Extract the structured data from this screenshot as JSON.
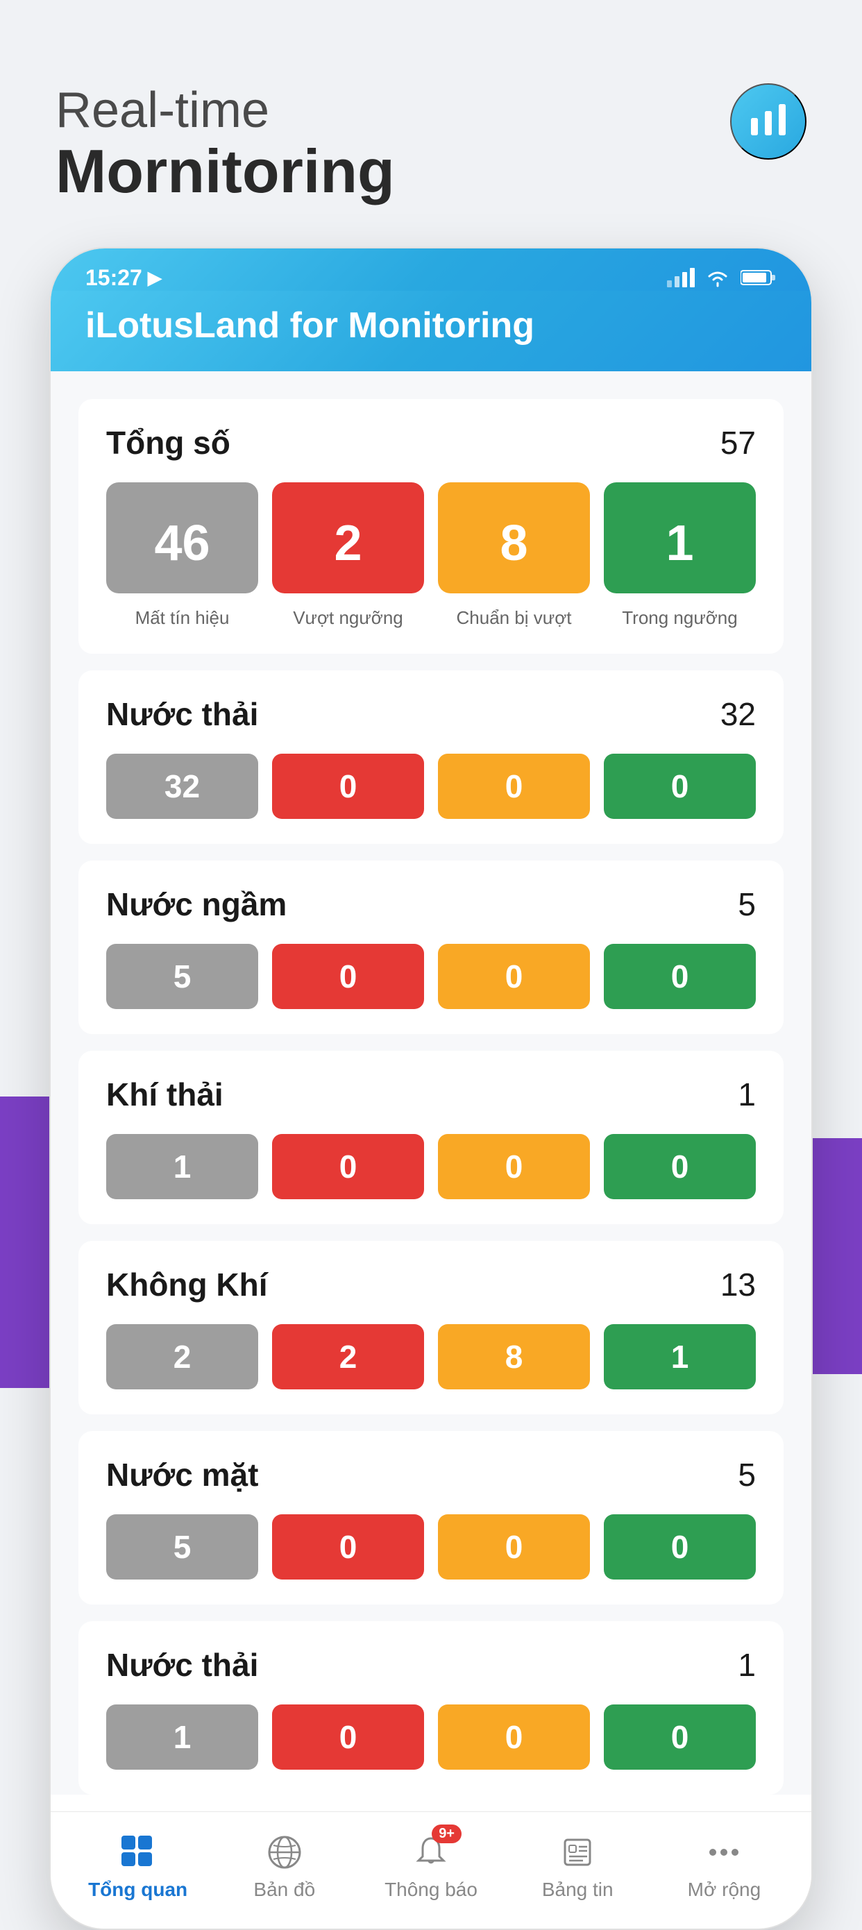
{
  "header": {
    "subtitle": "Real-time",
    "title": "Mornitoring",
    "icon_label": "monitor-icon"
  },
  "app": {
    "status_bar": {
      "time": "15:27",
      "nav_arrow": "▶"
    },
    "title": "iLotusLand for Monitoring"
  },
  "tong_so": {
    "label": "Tổng số",
    "count": 57,
    "cards": [
      {
        "number": 46,
        "label": "Mất tín hiệu",
        "color": "gray"
      },
      {
        "number": 2,
        "label": "Vượt ngưỡng",
        "color": "red"
      },
      {
        "number": 8,
        "label": "Chuẩn bị vượt",
        "color": "yellow"
      },
      {
        "number": 1,
        "label": "Trong ngưỡng",
        "color": "green"
      }
    ]
  },
  "sections": [
    {
      "label": "Nước thải",
      "count": 32,
      "pills": [
        {
          "number": 32,
          "color": "gray"
        },
        {
          "number": 0,
          "color": "red"
        },
        {
          "number": 0,
          "color": "yellow"
        },
        {
          "number": 0,
          "color": "green"
        }
      ]
    },
    {
      "label": "Nước ngầm",
      "count": 5,
      "pills": [
        {
          "number": 5,
          "color": "gray"
        },
        {
          "number": 0,
          "color": "red"
        },
        {
          "number": 0,
          "color": "yellow"
        },
        {
          "number": 0,
          "color": "green"
        }
      ]
    },
    {
      "label": "Khí thải",
      "count": 1,
      "pills": [
        {
          "number": 1,
          "color": "gray"
        },
        {
          "number": 0,
          "color": "red"
        },
        {
          "number": 0,
          "color": "yellow"
        },
        {
          "number": 0,
          "color": "green"
        }
      ]
    },
    {
      "label": "Không Khí",
      "count": 13,
      "pills": [
        {
          "number": 2,
          "color": "gray"
        },
        {
          "number": 2,
          "color": "red"
        },
        {
          "number": 8,
          "color": "yellow"
        },
        {
          "number": 1,
          "color": "green"
        }
      ]
    },
    {
      "label": "Nước mặt",
      "count": 5,
      "pills": [
        {
          "number": 5,
          "color": "gray"
        },
        {
          "number": 0,
          "color": "red"
        },
        {
          "number": 0,
          "color": "yellow"
        },
        {
          "number": 0,
          "color": "green"
        }
      ]
    },
    {
      "label": "Nước thải",
      "count": 1,
      "pills": [
        {
          "number": 1,
          "color": "gray"
        },
        {
          "number": 0,
          "color": "red"
        },
        {
          "number": 0,
          "color": "yellow"
        },
        {
          "number": 0,
          "color": "green"
        }
      ]
    }
  ],
  "bottom_nav": [
    {
      "id": "tong-quan",
      "label": "Tổng quan",
      "active": true,
      "badge": null
    },
    {
      "id": "ban-do",
      "label": "Bản đồ",
      "active": false,
      "badge": null
    },
    {
      "id": "thong-bao",
      "label": "Thông báo",
      "active": false,
      "badge": "9+"
    },
    {
      "id": "bang-tin",
      "label": "Bảng tin",
      "active": false,
      "badge": null
    },
    {
      "id": "mo-rong",
      "label": "Mở rộng",
      "active": false,
      "badge": null
    }
  ]
}
